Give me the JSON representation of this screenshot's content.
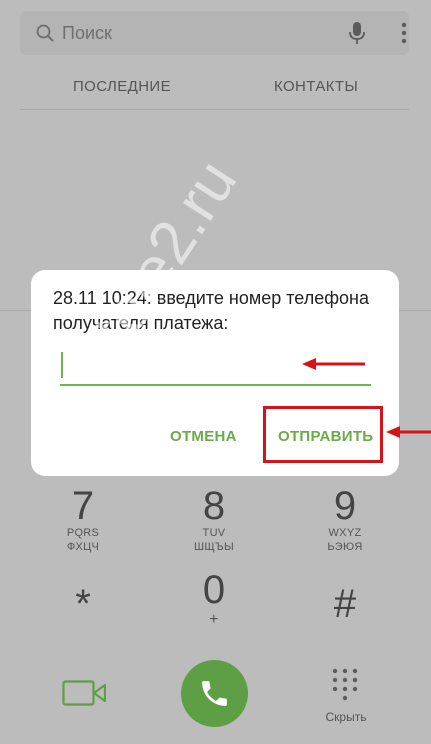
{
  "search": {
    "placeholder": "Поиск"
  },
  "tabs": [
    {
      "label": "ПОСЛЕДНИЕ"
    },
    {
      "label": "КОНТАКТЫ"
    }
  ],
  "dialog": {
    "message": "28.11 10:24: введите номер телефона получателя платежа:",
    "input_value": "",
    "cancel_label": "ОТМЕНА",
    "send_label": "ОТПРАВИТЬ"
  },
  "watermark": "otele2.ru",
  "keypad": {
    "k7": {
      "digit": "7",
      "latin": "PQRS",
      "cyrillic": "ФХЦЧ"
    },
    "k8": {
      "digit": "8",
      "latin": "TUV",
      "cyrillic": "ШЩЪЫ"
    },
    "k9": {
      "digit": "9",
      "latin": "WXYZ",
      "cyrillic": "ЬЭЮЯ"
    },
    "star": {
      "digit": "*"
    },
    "k0": {
      "digit": "0",
      "sub": "+"
    },
    "hash": {
      "digit": "#"
    }
  },
  "bottom": {
    "hide_label": "Скрыть"
  },
  "colors": {
    "accent_green": "#6db64f",
    "call_green": "#5e9e45",
    "highlight_red": "#d4141a"
  }
}
